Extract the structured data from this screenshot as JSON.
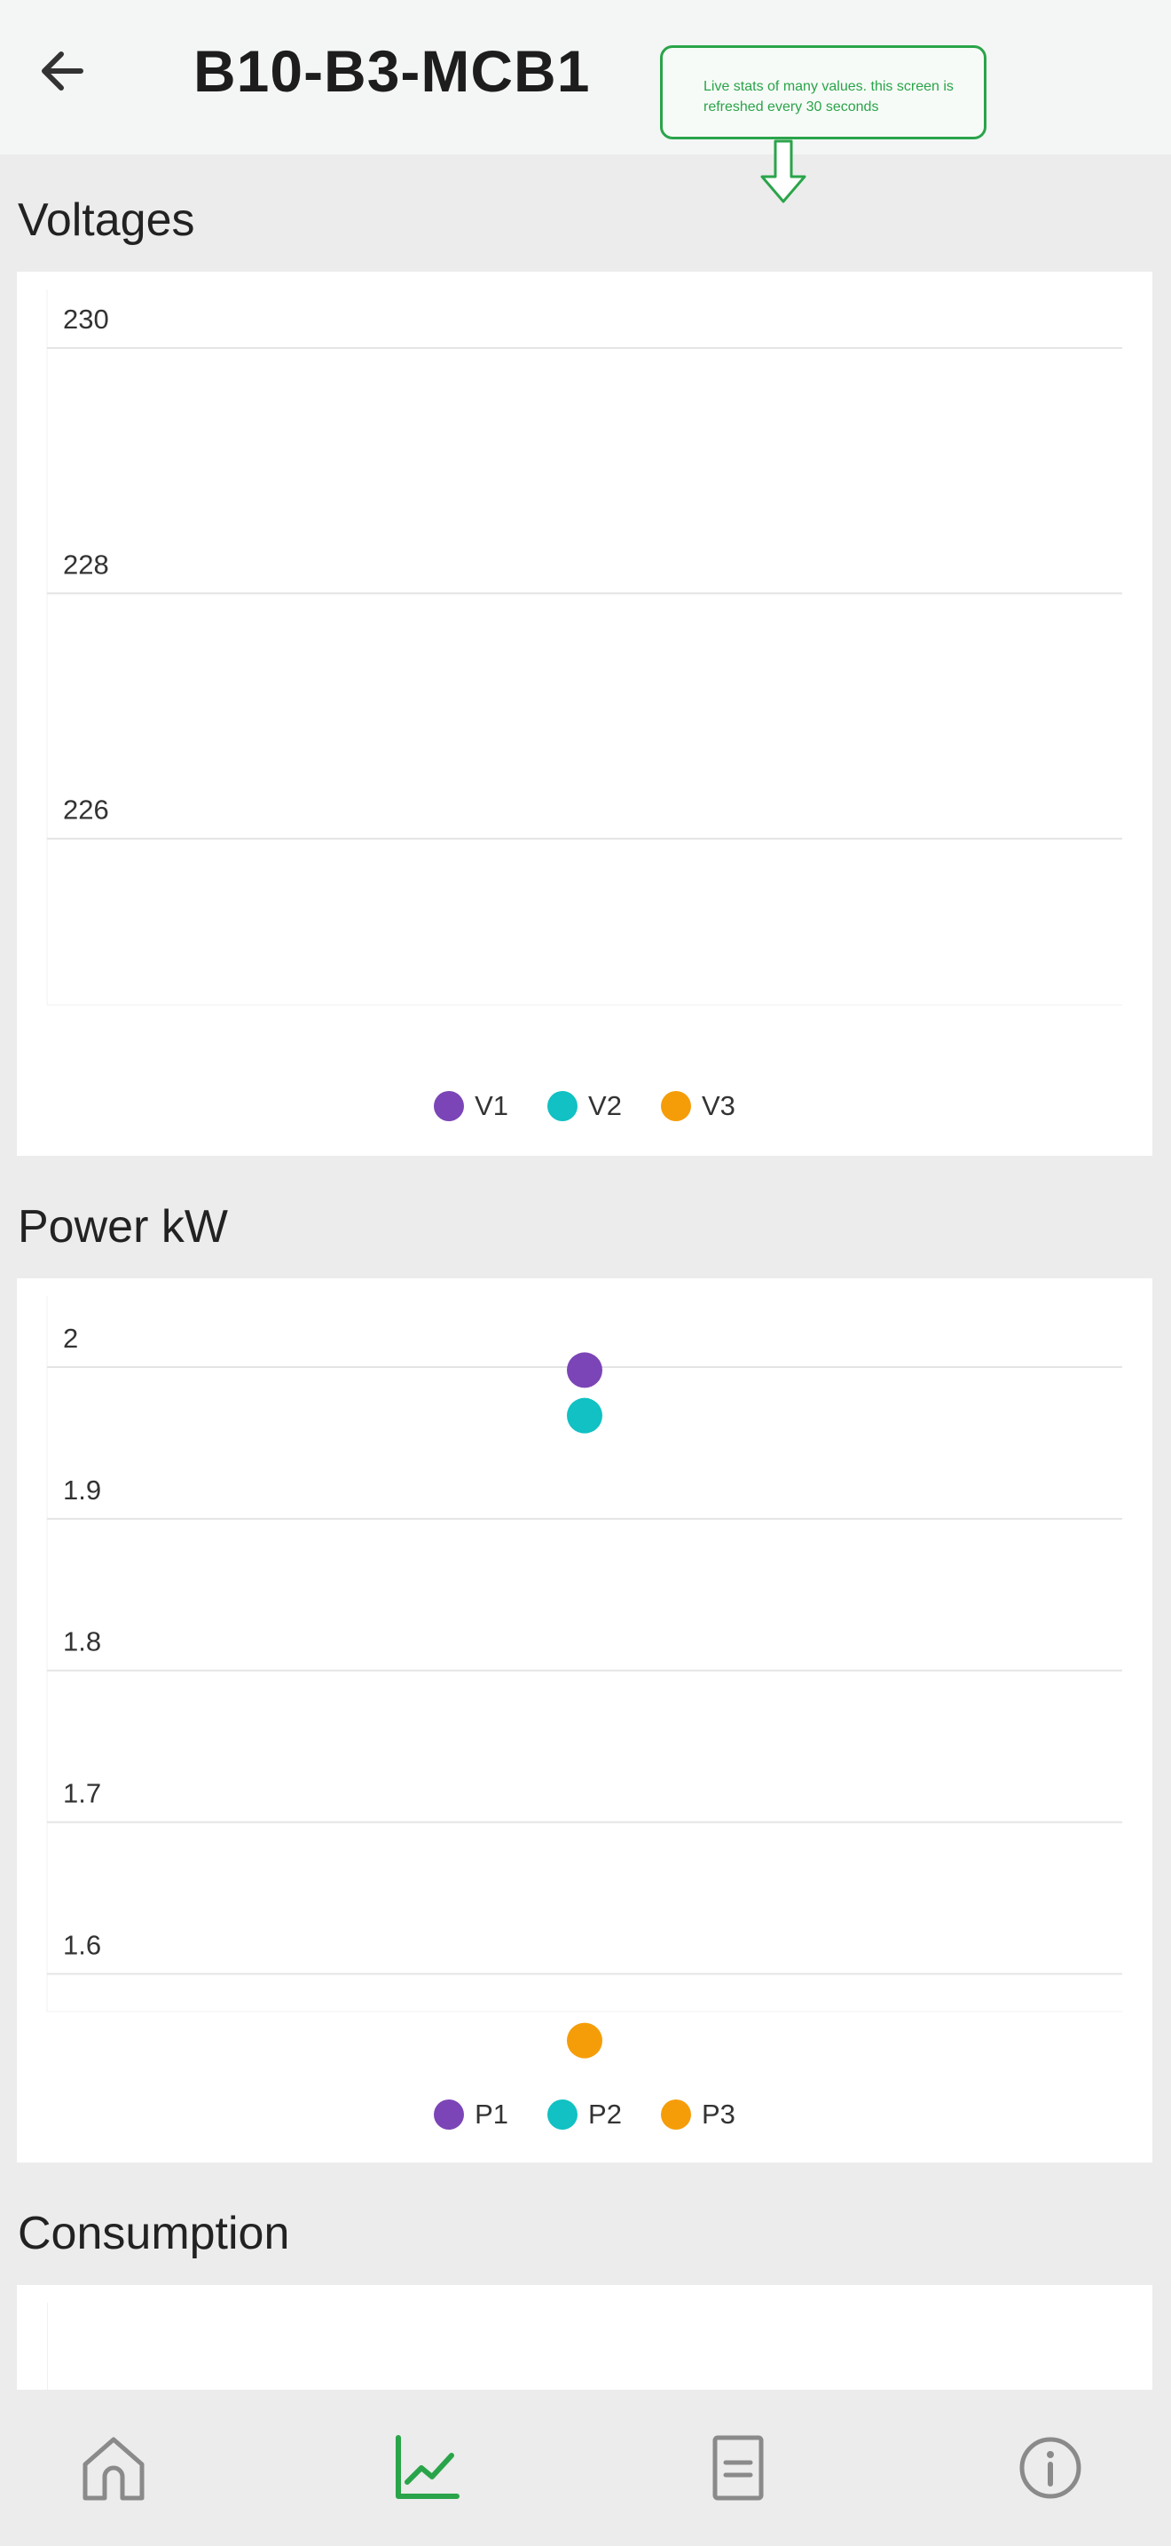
{
  "header": {
    "title": "B10-B3-MCB1",
    "back_icon": "arrow-left-icon"
  },
  "callout": {
    "text": "Live stats of many values. this screen is refreshed every 30 seconds"
  },
  "sections": {
    "voltages": {
      "title": "Voltages"
    },
    "power": {
      "title": "Power kW"
    },
    "consumption": {
      "title": "Consumption"
    }
  },
  "colors": {
    "s1": "#7b45b7",
    "s2": "#11c1c3",
    "s3": "#f59d09",
    "accent": "#2aa44a",
    "nav_icon": "#8a8a8a"
  },
  "chart_data": [
    {
      "type": "scatter",
      "title": "Voltages",
      "yticks": [
        "230",
        "228",
        "226"
      ],
      "ylim": [
        224.5,
        230
      ],
      "grid": true,
      "legend_position": "bottom",
      "series": [
        {
          "name": "V1",
          "values": []
        },
        {
          "name": "V2",
          "values": []
        },
        {
          "name": "V3",
          "values": []
        }
      ]
    },
    {
      "type": "scatter",
      "title": "Power kW",
      "yticks": [
        "2",
        "1.9",
        "1.8",
        "1.7",
        "1.6"
      ],
      "ylim": [
        1.54,
        2.0
      ],
      "grid": true,
      "legend_position": "bottom",
      "series": [
        {
          "name": "P1",
          "values": [
            1.998
          ]
        },
        {
          "name": "P2",
          "values": [
            1.968
          ]
        },
        {
          "name": "P3",
          "values": [
            1.556
          ]
        }
      ]
    }
  ],
  "nav": {
    "items": [
      {
        "name": "home",
        "icon": "home-icon",
        "active": false
      },
      {
        "name": "charts",
        "icon": "line-chart-icon",
        "active": true
      },
      {
        "name": "reports",
        "icon": "document-icon",
        "active": false
      },
      {
        "name": "info",
        "icon": "info-icon",
        "active": false
      }
    ]
  }
}
